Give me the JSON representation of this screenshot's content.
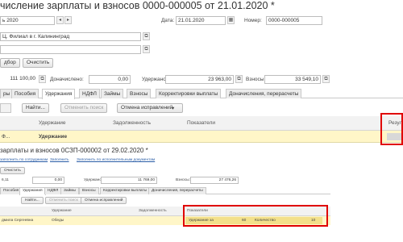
{
  "header": {
    "title": "числение зарплаты и взносов 0000-000005 от 21.01.2020 *",
    "month_value": "ь 2020",
    "date_label": "Дата:",
    "date_value": "21.01.2020",
    "number_label": "Номер:",
    "number_value": "0000-000005",
    "org_value": "Ц. Филиал в г. Калининград",
    "pick_btn": "дбор",
    "clear_btn": "Очистить",
    "total_accrued": "111 100,00",
    "extra_label": "Доначислено:",
    "extra_value": "0,00",
    "withheld_label": "Удержано:",
    "withheld_value": "23 963,00",
    "contrib_label": "Взносы:",
    "contrib_value": "33 549,10"
  },
  "tabs": [
    "ры",
    "Пособия",
    "Удержания",
    "НДФЛ",
    "Займы",
    "Взносы",
    "Корректировки выплаты",
    "Доначисления, перерасчеты"
  ],
  "toolbar": {
    "find": "Найти...",
    "cancel_search": "Отменить поиск",
    "undo_fixes": "Отмена исправлений"
  },
  "grid": {
    "columns": [
      "Удержание",
      "Задолженность",
      "Показатели",
      "Резул"
    ],
    "row": {
      "employee": "Ф...",
      "deduction": "Удержание"
    }
  },
  "inner": {
    "title": "зарплаты и взносов 0СЗП-000002 от 29.02.2020 *",
    "links": [
      "заполнить по сотрудникам",
      "Заполнить",
      "Заполнить по исполнительным документам"
    ],
    "clear_btn": "Очистить",
    "total_accrued": "6,11",
    "extra_value": "0,00",
    "withheld_label": "Удержано:",
    "withheld_value": "11 769,00",
    "contrib_label": "Взносы:",
    "contrib_value": "27 476,26",
    "tabs": [
      "Пособия",
      "Удержания",
      "НДФЛ",
      "Займы",
      "Взносы",
      "Корректировки выплаты",
      "Доначисления, перерасчеты"
    ],
    "toolbar": {
      "find": "Найти...",
      "cancel_search": "Отменить поиск",
      "undo_fixes": "Отмена исправлений"
    },
    "columns": [
      "Удержание",
      "Задолженность",
      "Показатели"
    ],
    "row": {
      "employee": "дмила Сергеевна",
      "deduction": "Обеды",
      "ind1_label": "Удержание за",
      "ind1_value": "60",
      "ind2_label": "Количество",
      "ind2_value": "10"
    }
  }
}
